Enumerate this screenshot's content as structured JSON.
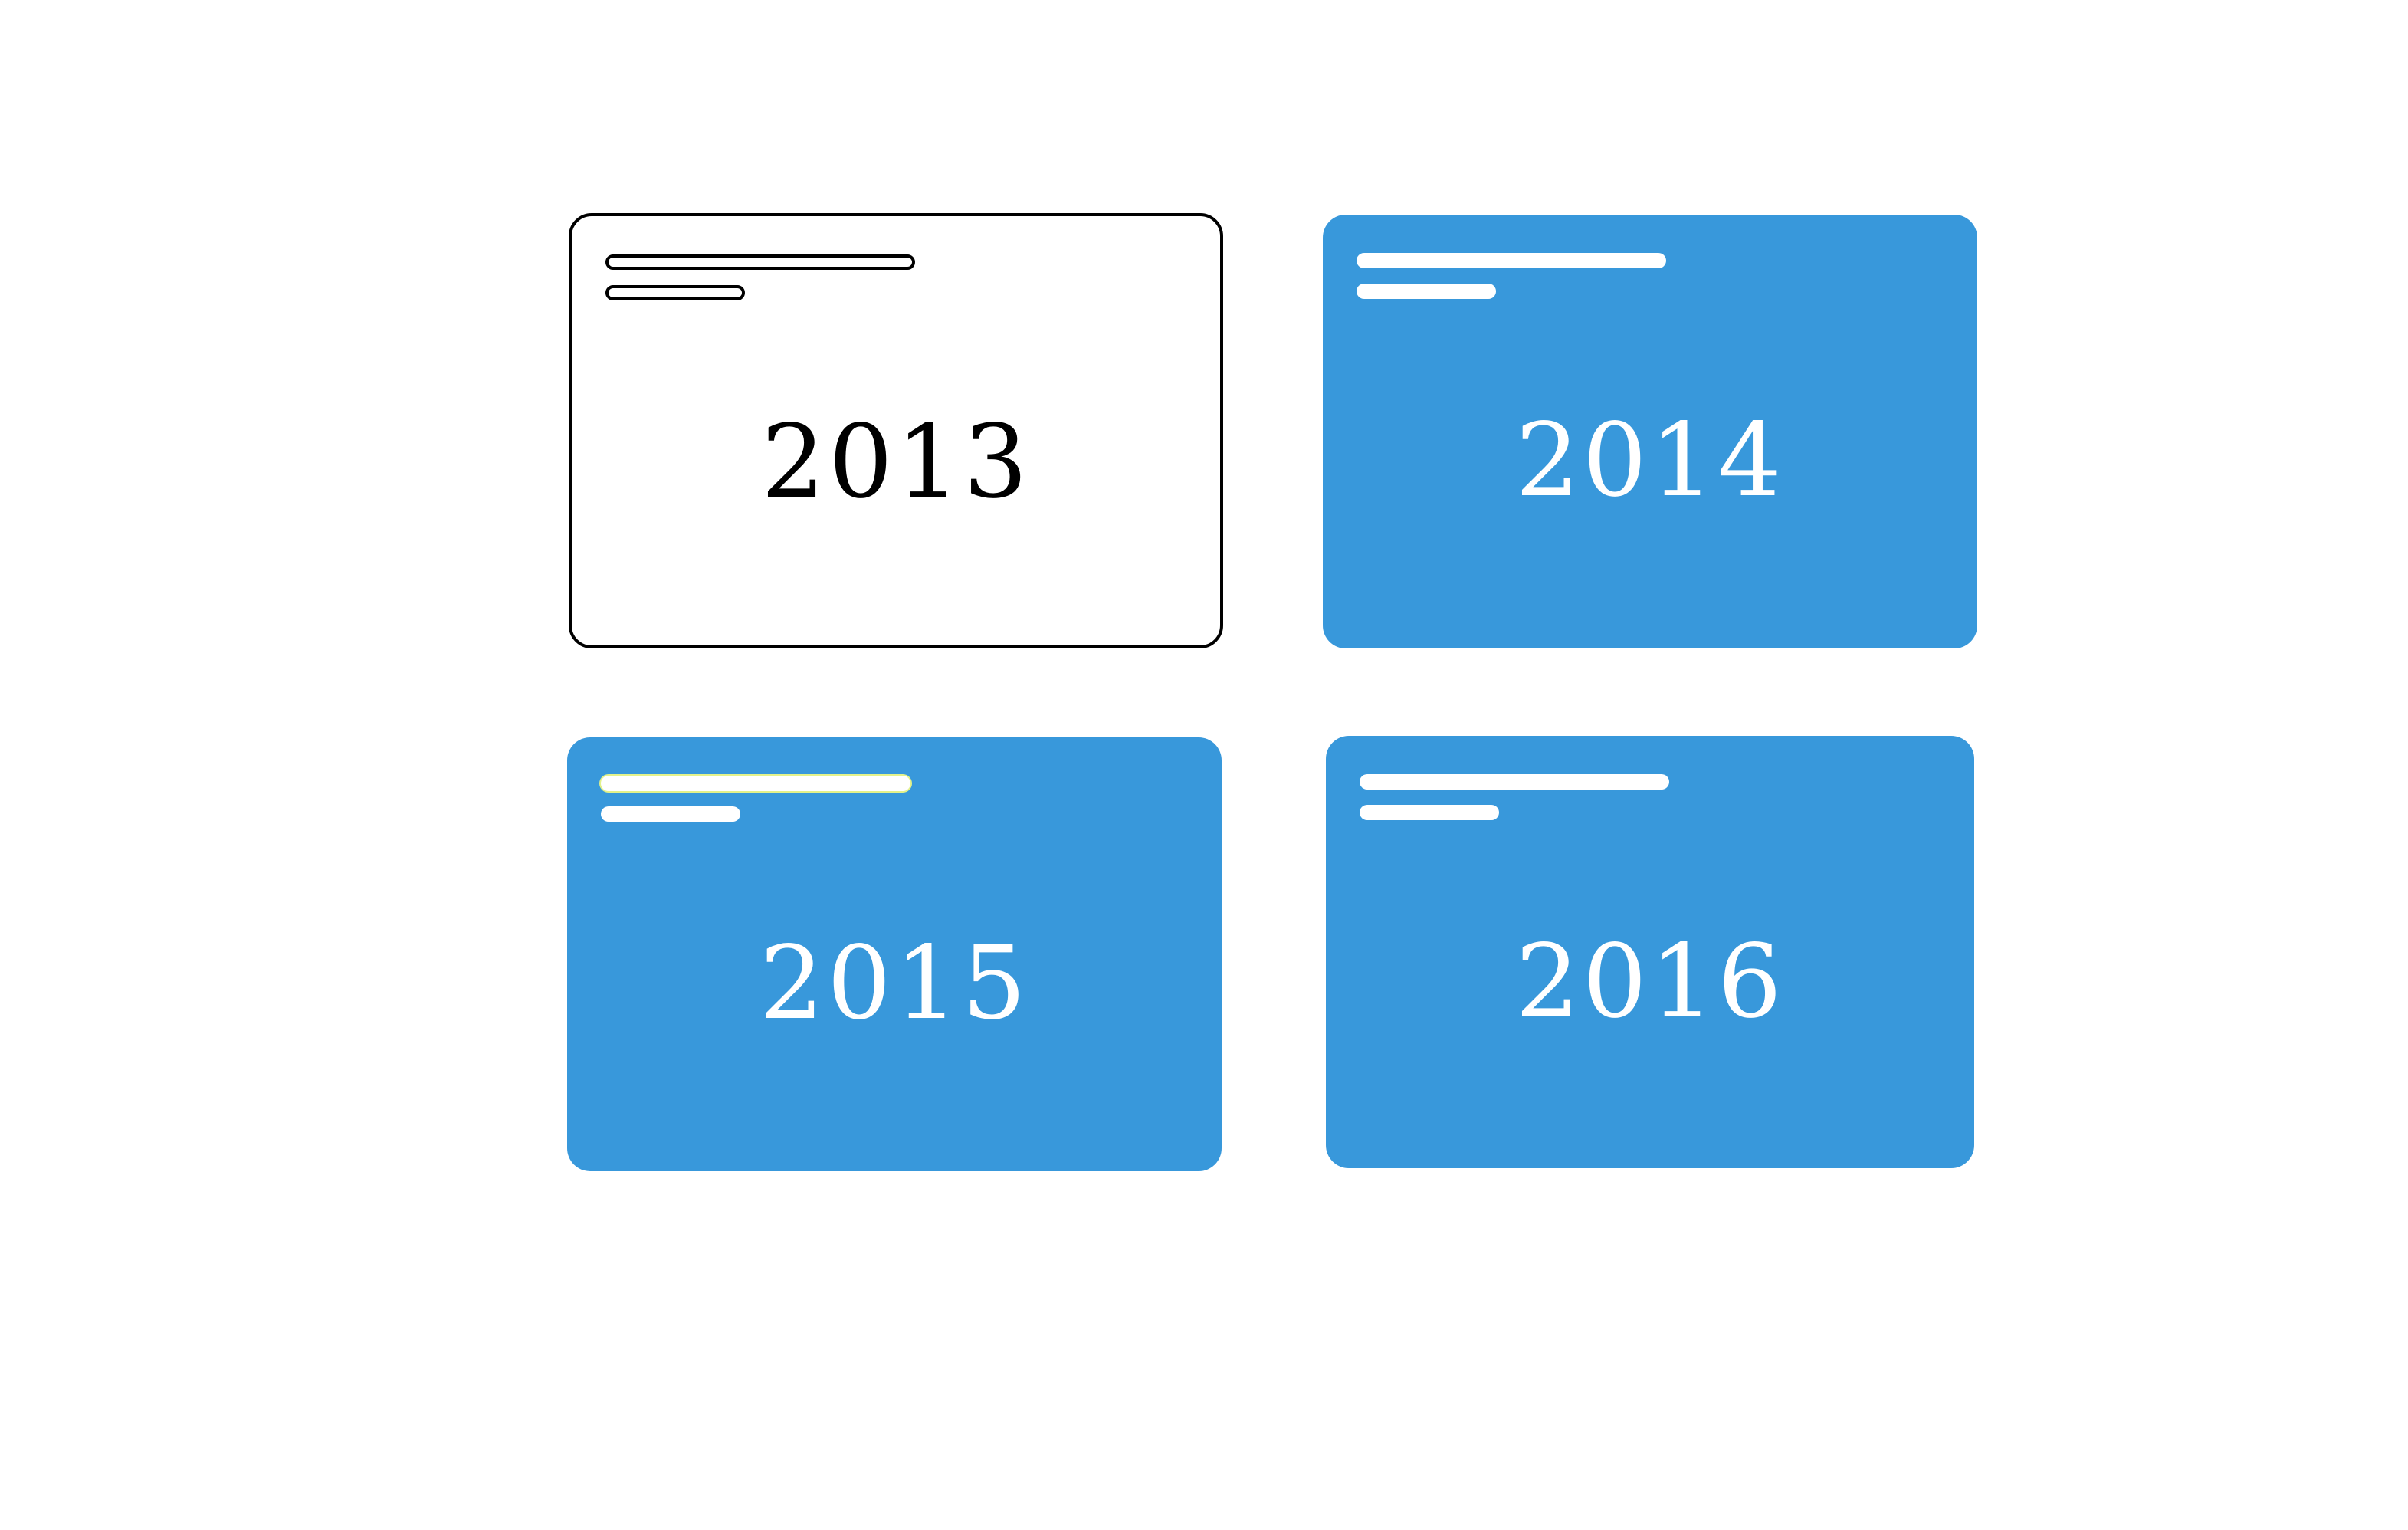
{
  "colors": {
    "card_fill": "#3898db",
    "outline": "#000000",
    "background": "#ffffff",
    "highlight": "#e3f28a"
  },
  "cards": [
    {
      "year": "2013",
      "style": "outlined",
      "highlighted": false
    },
    {
      "year": "2014",
      "style": "filled",
      "highlighted": false
    },
    {
      "year": "2015",
      "style": "filled",
      "highlighted": true
    },
    {
      "year": "2016",
      "style": "filled",
      "highlighted": false
    }
  ]
}
